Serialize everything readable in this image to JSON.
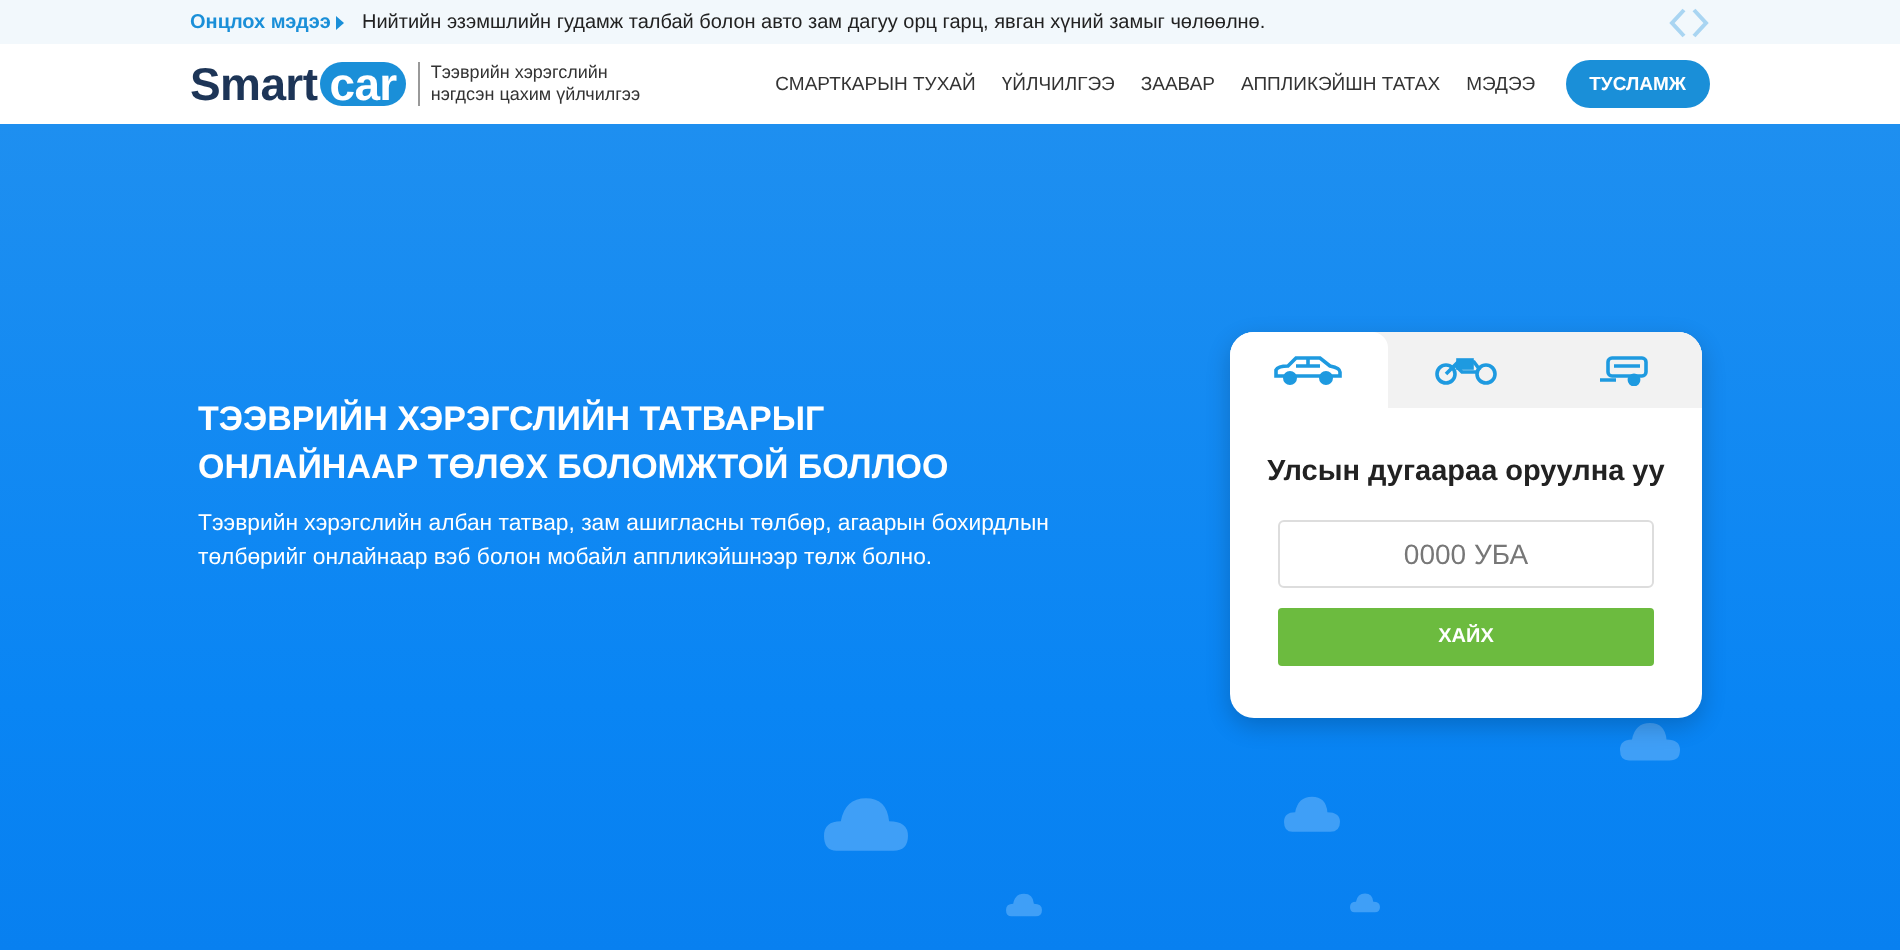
{
  "news_bar": {
    "label": "Онцлох мэдээ",
    "text": "Нийтийн эзэмшлийн гудамж талбай болон авто зам дагуу орц гарц, явган хүний замыг чөлөөлнө."
  },
  "header": {
    "logo": {
      "part_1": "Smart",
      "part_2": "car"
    },
    "tagline": [
      "Тээврийн хэрэгслийн",
      "нэгдсэн цахим үйлчилгээ"
    ],
    "nav": [
      "СМАРТКАРЫН ТУХАЙ",
      "ҮЙЛЧИЛГЭЭ",
      "ЗААВАР",
      "АППЛИКЭЙШН ТАТАХ",
      "МЭДЭЭ"
    ],
    "help_button": "ТУСЛАМЖ"
  },
  "hero": {
    "title": [
      "ТЭЭВРИЙН ХЭРЭГСЛИЙН ТАТВАРЫГ",
      "ОНЛАЙНААР ТӨЛӨХ БОЛОМЖТОЙ БОЛЛОО"
    ],
    "description": "Тээврийн хэрэгслийн албан татвар, зам ашигласны төлбөр, агаарын бохирдлын төлбөрийг онлайнаар вэб болон мобайл аппликэйшнээр төлж болно."
  },
  "search_card": {
    "tabs": [
      {
        "kind": "car",
        "selected": true
      },
      {
        "kind": "motorcycle",
        "selected": false
      },
      {
        "kind": "trailer",
        "selected": false
      }
    ],
    "heading": "Улсын дугаараа оруулна уу",
    "placeholder": "0000 УБА",
    "button": "ХАЙХ"
  }
}
